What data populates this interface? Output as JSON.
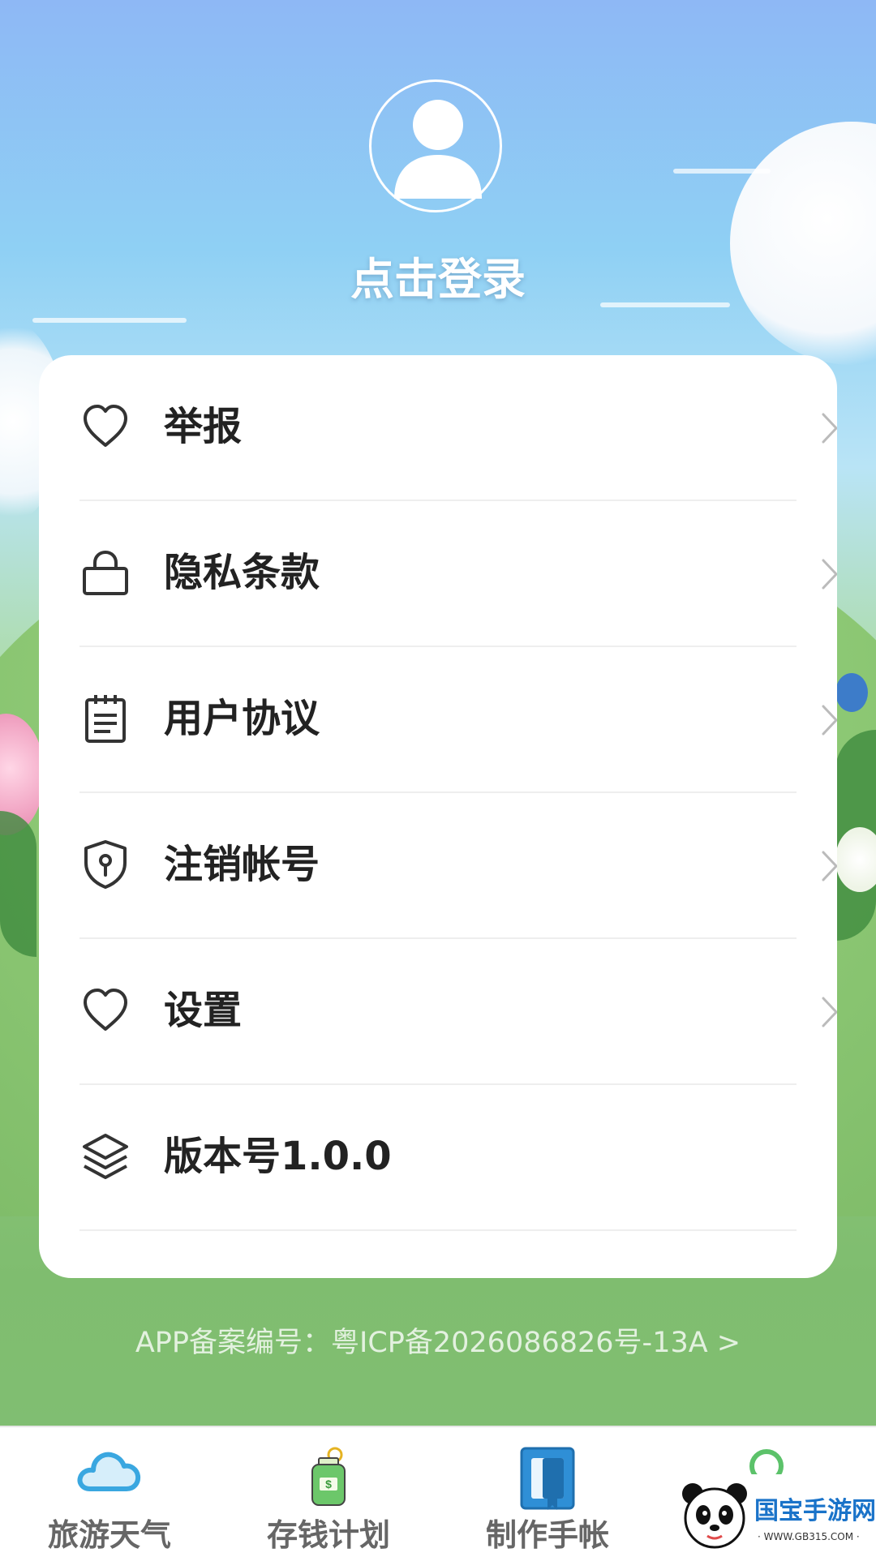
{
  "profile": {
    "login_text": "点击登录"
  },
  "menu": [
    {
      "label": "举报",
      "icon": "heart-icon"
    },
    {
      "label": "隐私条款",
      "icon": "lock-icon"
    },
    {
      "label": "用户协议",
      "icon": "document-icon"
    },
    {
      "label": "注销帐号",
      "icon": "shield-keyhole-icon"
    },
    {
      "label": "设置",
      "icon": "heart-icon"
    },
    {
      "label": "版本号1.0.0",
      "icon": "layers-icon"
    }
  ],
  "icp": "APP备案编号：粤ICP备2026086826号-13A >",
  "tabbar": [
    {
      "label": "旅游天气",
      "icon": "cloud-icon"
    },
    {
      "label": "存钱计划",
      "icon": "money-bag-icon"
    },
    {
      "label": "制作手帐",
      "icon": "notebook-icon"
    },
    {
      "label": "",
      "icon": "user-icon",
      "active": true
    }
  ],
  "watermark": {
    "text": "国宝手游网",
    "url": "· WWW.GB315.COM ·"
  },
  "colors": {
    "accent": "#3aa7e0",
    "active_tab": "#5cc26a",
    "text_dark": "#222222",
    "tab_text": "#666666"
  }
}
